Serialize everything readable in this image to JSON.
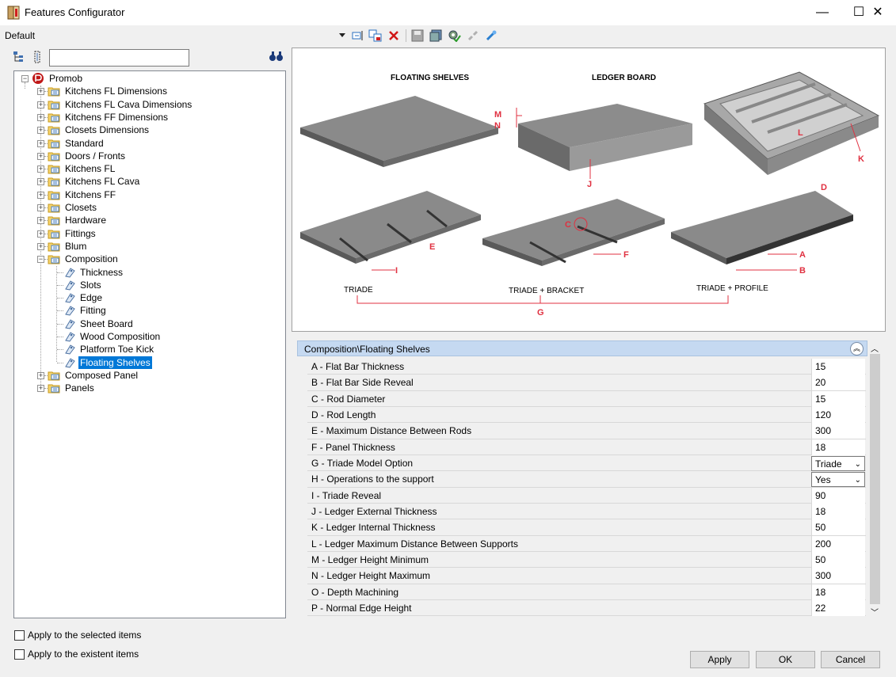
{
  "window": {
    "title": "Features Configurator",
    "minimize": "—",
    "maximize": "☐",
    "close": "✕"
  },
  "config_name": "Default",
  "toolbar": {
    "icons": [
      "dropdown-arrow-icon",
      "rename-icon",
      "copy-icon",
      "delete-icon",
      "save-icon",
      "save-all-icon",
      "settings-icon",
      "unlink-icon",
      "link-icon"
    ]
  },
  "search": {
    "value": "",
    "placeholder": ""
  },
  "tree": {
    "root": "Promob",
    "items": [
      {
        "label": "Kitchens FL Dimensions"
      },
      {
        "label": "Kitchens FL Cava Dimensions"
      },
      {
        "label": "Kitchens FF Dimensions"
      },
      {
        "label": "Closets Dimensions"
      },
      {
        "label": "Standard"
      },
      {
        "label": "Doors / Fronts"
      },
      {
        "label": "Kitchens FL"
      },
      {
        "label": "Kitchens FL Cava"
      },
      {
        "label": "Kitchens FF"
      },
      {
        "label": "Closets"
      },
      {
        "label": "Hardware"
      },
      {
        "label": "Fittings"
      },
      {
        "label": "Blum"
      },
      {
        "label": "Composition"
      }
    ],
    "composition_children": [
      "Thickness",
      "Slots",
      "Edge",
      "Fitting",
      "Sheet Board",
      "Wood Composition",
      "Platform Toe Kick",
      "Floating Shelves"
    ],
    "after_items": [
      {
        "label": "Composed Panel"
      },
      {
        "label": "Panels"
      }
    ],
    "selected": "Floating Shelves"
  },
  "diagram": {
    "heading_floating": "FLOATING SHELVES",
    "heading_ledger": "LEDGER BOARD",
    "caption_triade": "TRIADE",
    "caption_bracket": "TRIADE + BRACKET",
    "caption_profile": "TRIADE + PROFILE",
    "letters": {
      "A": "A",
      "B": "B",
      "C": "C",
      "D": "D",
      "E": "E",
      "F": "F",
      "G": "G",
      "I": "I",
      "J": "J",
      "K": "K",
      "L": "L",
      "M": "M",
      "N": "N"
    }
  },
  "properties": {
    "path": "Composition\\Floating Shelves",
    "rows": [
      {
        "name": "A - Flat Bar Thickness",
        "value": "15"
      },
      {
        "name": "B - Flat Bar Side Reveal",
        "value": "20"
      },
      {
        "name": "C - Rod Diameter",
        "value": "15"
      },
      {
        "name": "D - Rod Length",
        "value": "120"
      },
      {
        "name": "E - Maximum Distance Between Rods",
        "value": "300"
      },
      {
        "name": "F - Panel Thickness",
        "value": "18"
      },
      {
        "name": "G - Triade Model Option",
        "value": "Triade",
        "type": "select"
      },
      {
        "name": "H - Operations to the support",
        "value": "Yes",
        "type": "select"
      },
      {
        "name": "I - Triade Reveal",
        "value": "90"
      },
      {
        "name": "J - Ledger External Thickness",
        "value": "18"
      },
      {
        "name": "K - Ledger Internal Thickness",
        "value": "50"
      },
      {
        "name": "L - Ledger Maximum Distance Between Supports",
        "value": "200"
      },
      {
        "name": "M - Ledger Height Minimum",
        "value": "50"
      },
      {
        "name": "N - Ledger Height Maximum",
        "value": "300"
      },
      {
        "name": "O - Depth Machining",
        "value": "18"
      },
      {
        "name": "P - Normal Edge Height",
        "value": "22"
      }
    ]
  },
  "options": {
    "apply_selected": "Apply to the selected items",
    "apply_existent": "Apply to the existent items"
  },
  "buttons": {
    "apply": "Apply",
    "ok": "OK",
    "cancel": "Cancel"
  },
  "colors": {
    "accent": "#0078d7",
    "header": "#c5d9f1",
    "annot": "#e03040"
  }
}
